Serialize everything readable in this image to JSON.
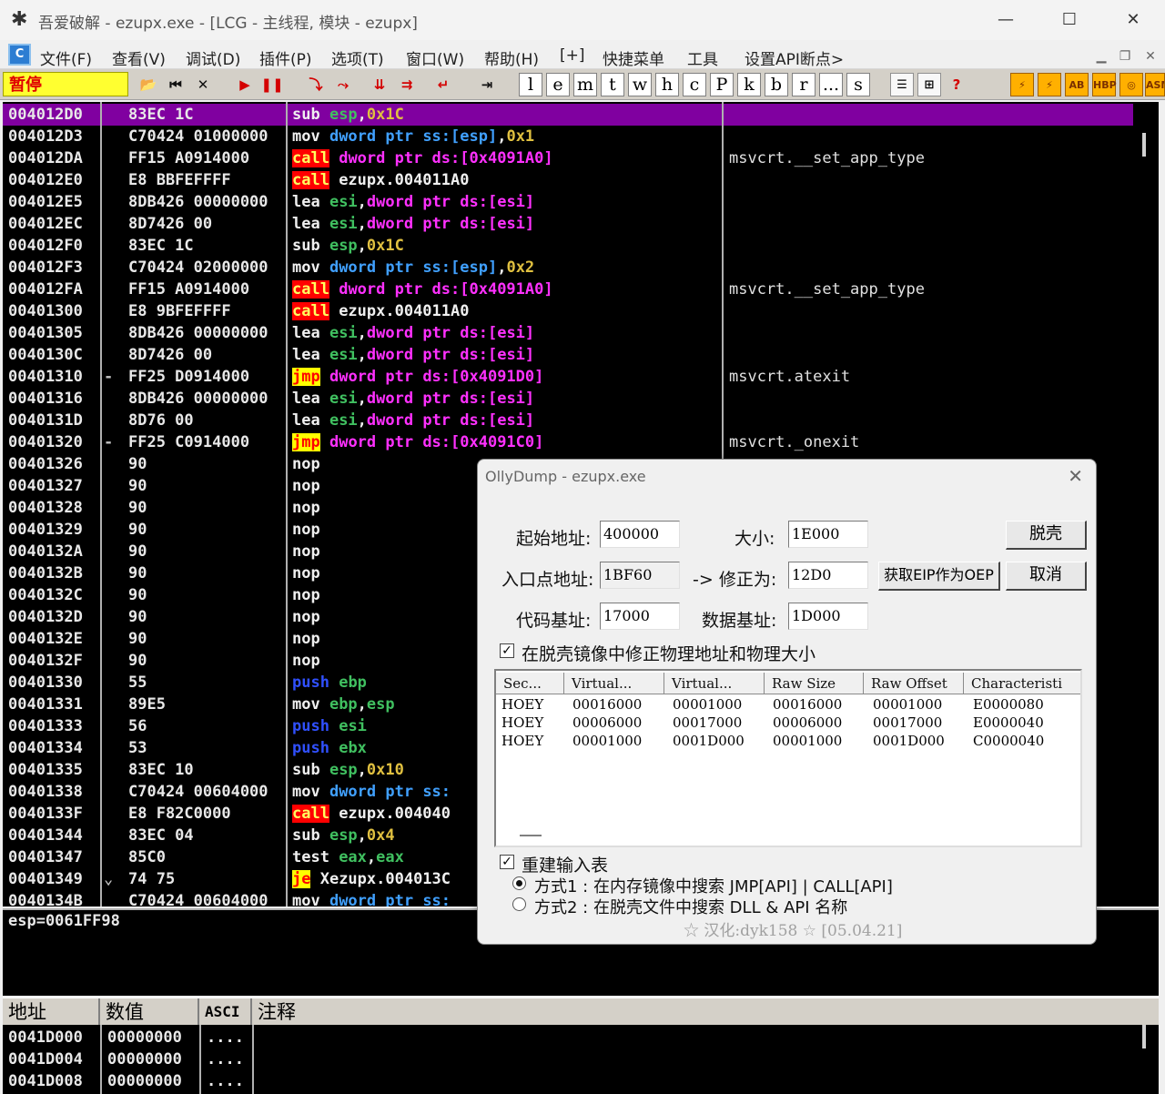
{
  "window": {
    "title": "吾爱破解 - ezupx.exe - [LCG - 主线程, 模块 - ezupx]",
    "app_icon": "spider-icon"
  },
  "menu": {
    "items": [
      "文件(F)",
      "查看(V)",
      "调试(D)",
      "插件(P)",
      "选项(T)",
      "窗口(W)",
      "帮助(H)",
      "[+]",
      "快捷菜单",
      "工具",
      "设置API断点>"
    ]
  },
  "toolbar": {
    "status": "暂停",
    "letter_buttons": [
      "l",
      "e",
      "m",
      "t",
      "w",
      "h",
      "c",
      "P",
      "k",
      "b",
      "r",
      "...",
      "s"
    ],
    "right_labels": [
      "HBP",
      "ASM"
    ]
  },
  "disasm": {
    "rows": [
      {
        "addr": "004012D0",
        "mark": "",
        "hex": "83EC 1C",
        "cmt": "",
        "asm": [
          [
            "t-op",
            "sub "
          ],
          [
            "t-reg",
            "esp"
          ],
          [
            "t-op",
            ","
          ],
          [
            "t-num",
            "0x1C"
          ]
        ]
      },
      {
        "addr": "004012D3",
        "mark": "",
        "hex": "C70424 01000000",
        "cmt": "",
        "asm": [
          [
            "t-op",
            "mov "
          ],
          [
            "t-kw",
            "dword ptr "
          ],
          [
            "t-kw",
            "ss:[esp]"
          ],
          [
            "t-op",
            ","
          ],
          [
            "t-num",
            "0x1"
          ]
        ]
      },
      {
        "addr": "004012DA",
        "mark": "",
        "hex": "FF15 A0914000",
        "cmt": "msvcrt.__set_app_type",
        "asm": [
          [
            "t-call",
            "call"
          ],
          [
            "t-op",
            " "
          ],
          [
            "t-ptr",
            "dword ptr ds:[0x4091A0]"
          ]
        ]
      },
      {
        "addr": "004012E0",
        "mark": "",
        "hex": "E8 BBFEFFFF",
        "cmt": "",
        "asm": [
          [
            "t-call",
            "call"
          ],
          [
            "t-op",
            " ezupx.004011A0"
          ]
        ]
      },
      {
        "addr": "004012E5",
        "mark": "",
        "hex": "8DB426 00000000",
        "cmt": "",
        "asm": [
          [
            "t-op",
            "lea "
          ],
          [
            "t-reg",
            "esi"
          ],
          [
            "t-op",
            ","
          ],
          [
            "t-ptr",
            "dword ptr ds:[esi]"
          ]
        ]
      },
      {
        "addr": "004012EC",
        "mark": "",
        "hex": "8D7426 00",
        "cmt": "",
        "asm": [
          [
            "t-op",
            "lea "
          ],
          [
            "t-reg",
            "esi"
          ],
          [
            "t-op",
            ","
          ],
          [
            "t-ptr",
            "dword ptr ds:[esi]"
          ]
        ]
      },
      {
        "addr": "004012F0",
        "mark": "",
        "hex": "83EC 1C",
        "cmt": "",
        "asm": [
          [
            "t-op",
            "sub "
          ],
          [
            "t-reg",
            "esp"
          ],
          [
            "t-op",
            ","
          ],
          [
            "t-num",
            "0x1C"
          ]
        ]
      },
      {
        "addr": "004012F3",
        "mark": "",
        "hex": "C70424 02000000",
        "cmt": "",
        "asm": [
          [
            "t-op",
            "mov "
          ],
          [
            "t-kw",
            "dword ptr "
          ],
          [
            "t-kw",
            "ss:[esp]"
          ],
          [
            "t-op",
            ","
          ],
          [
            "t-num",
            "0x2"
          ]
        ]
      },
      {
        "addr": "004012FA",
        "mark": "",
        "hex": "FF15 A0914000",
        "cmt": "msvcrt.__set_app_type",
        "asm": [
          [
            "t-call",
            "call"
          ],
          [
            "t-op",
            " "
          ],
          [
            "t-ptr",
            "dword ptr ds:[0x4091A0]"
          ]
        ]
      },
      {
        "addr": "00401300",
        "mark": "",
        "hex": "E8 9BFEFFFF",
        "cmt": "",
        "asm": [
          [
            "t-call",
            "call"
          ],
          [
            "t-op",
            " ezupx.004011A0"
          ]
        ]
      },
      {
        "addr": "00401305",
        "mark": "",
        "hex": "8DB426 00000000",
        "cmt": "",
        "asm": [
          [
            "t-op",
            "lea "
          ],
          [
            "t-reg",
            "esi"
          ],
          [
            "t-op",
            ","
          ],
          [
            "t-ptr",
            "dword ptr ds:[esi]"
          ]
        ]
      },
      {
        "addr": "0040130C",
        "mark": "",
        "hex": "8D7426 00",
        "cmt": "",
        "asm": [
          [
            "t-op",
            "lea "
          ],
          [
            "t-reg",
            "esi"
          ],
          [
            "t-op",
            ","
          ],
          [
            "t-ptr",
            "dword ptr ds:[esi]"
          ]
        ]
      },
      {
        "addr": "00401310",
        "mark": "-",
        "hex": "FF25 D0914000",
        "cmt": "msvcrt.atexit",
        "asm": [
          [
            "t-jmp",
            "jmp"
          ],
          [
            "t-op",
            " "
          ],
          [
            "t-ptr",
            "dword ptr ds:[0x4091D0]"
          ]
        ]
      },
      {
        "addr": "00401316",
        "mark": "",
        "hex": "8DB426 00000000",
        "cmt": "",
        "asm": [
          [
            "t-op",
            "lea "
          ],
          [
            "t-reg",
            "esi"
          ],
          [
            "t-op",
            ","
          ],
          [
            "t-ptr",
            "dword ptr ds:[esi]"
          ]
        ]
      },
      {
        "addr": "0040131D",
        "mark": "",
        "hex": "8D76 00",
        "cmt": "",
        "asm": [
          [
            "t-op",
            "lea "
          ],
          [
            "t-reg",
            "esi"
          ],
          [
            "t-op",
            ","
          ],
          [
            "t-ptr",
            "dword ptr ds:[esi]"
          ]
        ]
      },
      {
        "addr": "00401320",
        "mark": "-",
        "hex": "FF25 C0914000",
        "cmt": "msvcrt._onexit",
        "asm": [
          [
            "t-jmp",
            "jmp"
          ],
          [
            "t-op",
            " "
          ],
          [
            "t-ptr",
            "dword ptr ds:[0x4091C0]"
          ]
        ]
      },
      {
        "addr": "00401326",
        "mark": "",
        "hex": "90",
        "cmt": "",
        "asm": [
          [
            "t-op",
            "nop"
          ]
        ]
      },
      {
        "addr": "00401327",
        "mark": "",
        "hex": "90",
        "cmt": "",
        "asm": [
          [
            "t-op",
            "nop"
          ]
        ]
      },
      {
        "addr": "00401328",
        "mark": "",
        "hex": "90",
        "cmt": "",
        "asm": [
          [
            "t-op",
            "nop"
          ]
        ]
      },
      {
        "addr": "00401329",
        "mark": "",
        "hex": "90",
        "cmt": "",
        "asm": [
          [
            "t-op",
            "nop"
          ]
        ]
      },
      {
        "addr": "0040132A",
        "mark": "",
        "hex": "90",
        "cmt": "",
        "asm": [
          [
            "t-op",
            "nop"
          ]
        ]
      },
      {
        "addr": "0040132B",
        "mark": "",
        "hex": "90",
        "cmt": "",
        "asm": [
          [
            "t-op",
            "nop"
          ]
        ]
      },
      {
        "addr": "0040132C",
        "mark": "",
        "hex": "90",
        "cmt": "",
        "asm": [
          [
            "t-op",
            "nop"
          ]
        ]
      },
      {
        "addr": "0040132D",
        "mark": "",
        "hex": "90",
        "cmt": "",
        "asm": [
          [
            "t-op",
            "nop"
          ]
        ]
      },
      {
        "addr": "0040132E",
        "mark": "",
        "hex": "90",
        "cmt": "",
        "asm": [
          [
            "t-op",
            "nop"
          ]
        ]
      },
      {
        "addr": "0040132F",
        "mark": "",
        "hex": "90",
        "cmt": "",
        "asm": [
          [
            "t-op",
            "nop"
          ]
        ]
      },
      {
        "addr": "00401330",
        "mark": "",
        "hex": "55",
        "cmt": "",
        "asm": [
          [
            "t-push",
            "push"
          ],
          [
            "t-op",
            " "
          ],
          [
            "t-reg",
            "ebp"
          ]
        ]
      },
      {
        "addr": "00401331",
        "mark": "",
        "hex": "89E5",
        "cmt": "",
        "asm": [
          [
            "t-op",
            "mov "
          ],
          [
            "t-reg",
            "ebp"
          ],
          [
            "t-op",
            ","
          ],
          [
            "t-reg",
            "esp"
          ]
        ]
      },
      {
        "addr": "00401333",
        "mark": "",
        "hex": "56",
        "cmt": "",
        "asm": [
          [
            "t-push",
            "push"
          ],
          [
            "t-op",
            " "
          ],
          [
            "t-reg",
            "esi"
          ]
        ]
      },
      {
        "addr": "00401334",
        "mark": "",
        "hex": "53",
        "cmt": "",
        "asm": [
          [
            "t-push",
            "push"
          ],
          [
            "t-op",
            " "
          ],
          [
            "t-reg",
            "ebx"
          ]
        ]
      },
      {
        "addr": "00401335",
        "mark": "",
        "hex": "83EC 10",
        "cmt": "",
        "asm": [
          [
            "t-op",
            "sub "
          ],
          [
            "t-reg",
            "esp"
          ],
          [
            "t-op",
            ","
          ],
          [
            "t-num",
            "0x10"
          ]
        ]
      },
      {
        "addr": "00401338",
        "mark": "",
        "hex": "C70424 00604000",
        "cmt": "",
        "asm": [
          [
            "t-op",
            "mov "
          ],
          [
            "t-kw",
            "dword ptr "
          ],
          [
            "t-kw",
            "ss:"
          ]
        ]
      },
      {
        "addr": "0040133F",
        "mark": "",
        "hex": "E8 F82C0000",
        "cmt": "",
        "asm": [
          [
            "t-call",
            "call"
          ],
          [
            "t-op",
            " ezupx.004040"
          ]
        ]
      },
      {
        "addr": "00401344",
        "mark": "",
        "hex": "83EC 04",
        "cmt": "",
        "asm": [
          [
            "t-op",
            "sub "
          ],
          [
            "t-reg",
            "esp"
          ],
          [
            "t-op",
            ","
          ],
          [
            "t-num",
            "0x4"
          ]
        ]
      },
      {
        "addr": "00401347",
        "mark": "",
        "hex": "85C0",
        "cmt": "",
        "asm": [
          [
            "t-op",
            "test "
          ],
          [
            "t-reg",
            "eax"
          ],
          [
            "t-op",
            ","
          ],
          [
            "t-reg",
            "eax"
          ]
        ]
      },
      {
        "addr": "00401349",
        "mark": "⌄",
        "hex": "74 75",
        "cmt": "",
        "asm": [
          [
            "t-jmp",
            "je"
          ],
          [
            "t-op",
            " Xezupx.004013C"
          ]
        ]
      },
      {
        "addr": "0040134B",
        "mark": "",
        "hex": "C70424 00604000",
        "cmt": "",
        "asm": [
          [
            "t-op",
            "mov "
          ],
          [
            "t-kw",
            "dword ptr "
          ],
          [
            "t-kw",
            "ss:"
          ]
        ]
      }
    ]
  },
  "info": {
    "text": "esp=0061FF98"
  },
  "dump": {
    "headers": [
      "地址",
      "数值",
      "ASCI",
      "注释"
    ],
    "rows": [
      {
        "addr": "0041D000",
        "val": "00000000",
        "asc": "...."
      },
      {
        "addr": "0041D004",
        "val": "00000000",
        "asc": "...."
      },
      {
        "addr": "0041D008",
        "val": "00000000",
        "asc": "...."
      }
    ]
  },
  "dialog": {
    "title": "OllyDump - ezupx.exe",
    "start_label": "起始地址:",
    "start_value": "400000",
    "size_label": "大小:",
    "size_value": "1E000",
    "ep_label": "入口点地址:",
    "ep_value": "1BF60",
    "fix_label": "-> 修正为:",
    "fix_value": "12D0",
    "code_label": "代码基址:",
    "code_value": "17000",
    "data_label": "数据基址:",
    "data_value": "1D000",
    "btn_dump": "脱壳",
    "btn_geteip": "获取EIP作为OEP",
    "btn_cancel": "取消",
    "fix_raw_label": "在脱壳镜像中修正物理地址和物理大小",
    "table_headers": [
      "Sec...",
      "Virtual...",
      "Virtual...",
      "Raw Size",
      "Raw Offset",
      "Characteristi"
    ],
    "table_rows": [
      [
        "HOEY",
        "00016000",
        "00001000",
        "00016000",
        "00001000",
        "E0000080"
      ],
      [
        "HOEY",
        "00006000",
        "00017000",
        "00006000",
        "00017000",
        "E0000040"
      ],
      [
        "HOEY",
        "00001000",
        "0001D000",
        "00001000",
        "0001D000",
        "C0000040"
      ]
    ],
    "rebuild_label": "重建输入表",
    "method1": "方式1 : 在内存镜像中搜索 JMP[API] | CALL[API]",
    "method2": "方式2 : 在脱壳文件中搜索 DLL & API 名称",
    "credit": "☆ 汉化:dyk158 ☆ [05.04.21]"
  }
}
